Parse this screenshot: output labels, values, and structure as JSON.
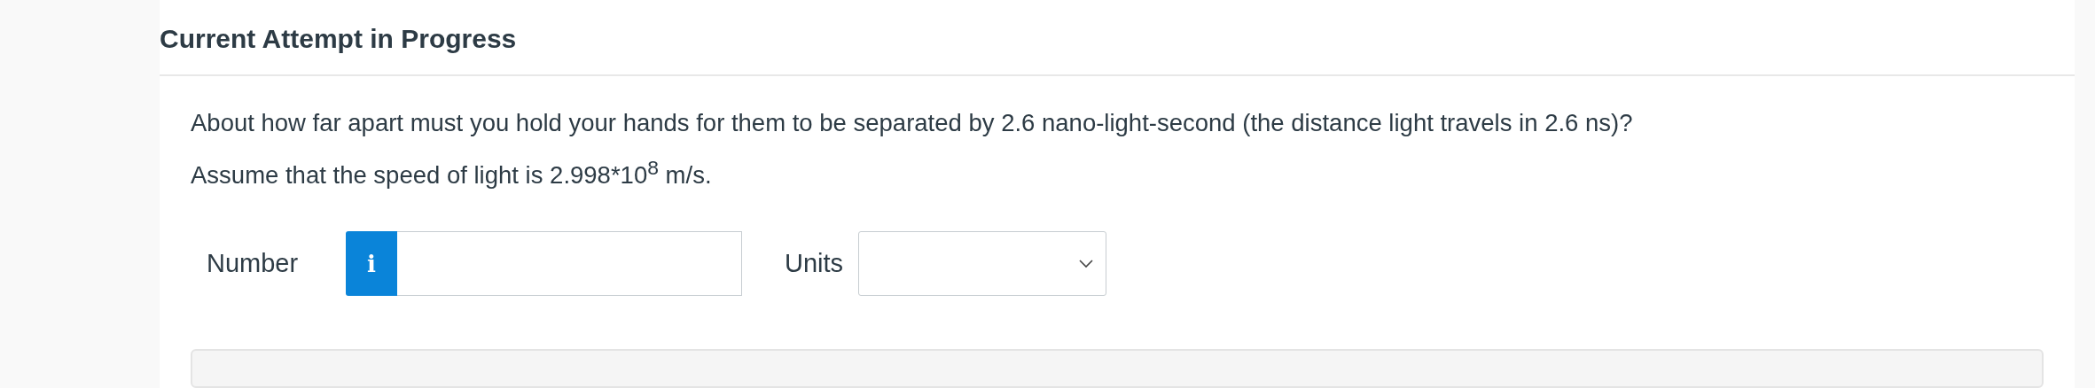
{
  "section": {
    "title": "Current Attempt in Progress"
  },
  "question": {
    "lines": [
      "About how far apart must you hold your hands for them to be separated by 2.6 nano-light-second (the distance light travels in 2.6 ns)?",
      "Assume that the speed of light is 2.998*10$^{8}$ m/s."
    ]
  },
  "answer": {
    "number_label": "Number",
    "info_button": "i",
    "units_label": "Units"
  }
}
